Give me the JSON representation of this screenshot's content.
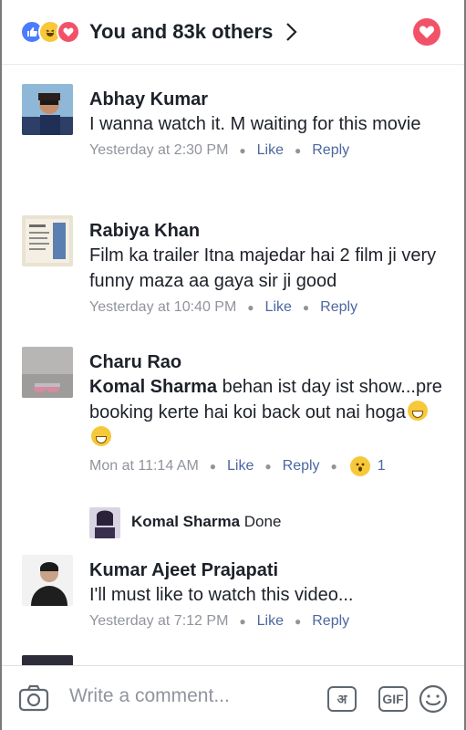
{
  "header": {
    "reactions": [
      "like-icon",
      "haha-icon",
      "love-icon"
    ],
    "reactors_text": "You and 83k others",
    "love_button_icon": "love-icon"
  },
  "comments": [
    {
      "author": "Abhay Kumar",
      "text": "I wanna watch it. M waiting for this movie",
      "time": "Yesterday at 2:30 PM",
      "like": "Like",
      "reply": "Reply"
    },
    {
      "author": "Rabiya Khan",
      "text": "Film ka trailer Itna majedar hai 2 film ji very funny maza aa gaya sir ji good",
      "time": "Yesterday at 10:40 PM",
      "like": "Like",
      "reply": "Reply"
    },
    {
      "author": "Charu Rao",
      "tag": "Komal Sharma",
      "text": " behan ist day ist show...pre booking kerte hai koi back out nai hoga",
      "time": "Mon at 11:14 AM",
      "like": "Like",
      "reply": "Reply",
      "reaction_icon": "wow-icon",
      "reaction_count": "1",
      "reply_thread": {
        "author": "Komal Sharma",
        "text": "Done"
      }
    },
    {
      "author": "Kumar Ajeet Prajapati",
      "text": "I'll must like to watch this video...",
      "time": "Yesterday at 7:12 PM",
      "like": "Like",
      "reply": "Reply"
    }
  ],
  "composer": {
    "placeholder": "Write a comment...",
    "hindi_button": "अ",
    "gif_button": "GIF",
    "camera_icon": "camera-icon",
    "emoji_icon": "smiley-icon"
  },
  "colors": {
    "link": "#4b67a1",
    "meta": "#90949c",
    "love": "#f25268",
    "like": "#4a7cff"
  }
}
